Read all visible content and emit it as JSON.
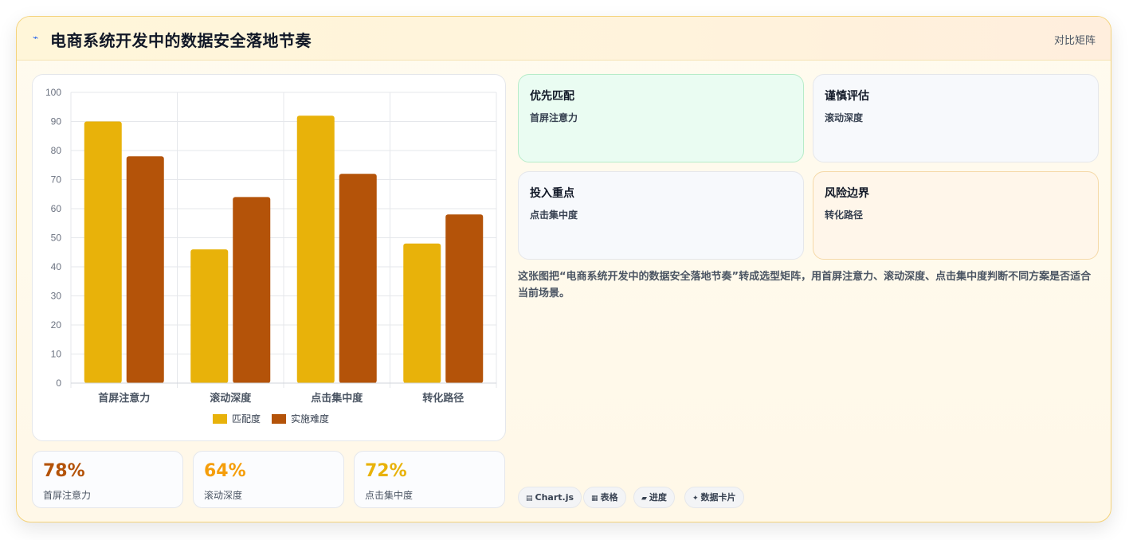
{
  "header": {
    "title": "电商系统开发中的数据安全落地节奏",
    "right_label": "对比矩阵"
  },
  "colors": {
    "series1": "#e8b20a",
    "series2": "#b45309",
    "grid": "#e5e7eb",
    "axis_text": "#6b7280"
  },
  "chart_data": {
    "type": "bar",
    "categories": [
      "首屏注意力",
      "滚动深度",
      "点击集中度",
      "转化路径"
    ],
    "series": [
      {
        "name": "匹配度",
        "values": [
          90,
          46,
          92,
          48
        ]
      },
      {
        "name": "实施难度",
        "values": [
          78,
          64,
          72,
          58
        ]
      }
    ],
    "ylim": [
      0,
      100
    ],
    "yticks": [
      0,
      10,
      20,
      30,
      40,
      50,
      60,
      70,
      80,
      90,
      100
    ],
    "legend": "bottom",
    "grid": true
  },
  "stats": [
    {
      "value": "78%",
      "label": "首屏注意力",
      "color": "#b45309"
    },
    {
      "value": "64%",
      "label": "滚动深度",
      "color": "#f59e0b"
    },
    {
      "value": "72%",
      "label": "点击集中度",
      "color": "#e8b20a"
    }
  ],
  "quadrants": [
    {
      "title": "优先匹配",
      "sub": "首屏注意力"
    },
    {
      "title": "谨慎评估",
      "sub": "滚动深度"
    },
    {
      "title": "投入重点",
      "sub": "点击集中度"
    },
    {
      "title": "风险边界",
      "sub": "转化路径"
    }
  ],
  "description": "这张图把“电商系统开发中的数据安全落地节奏”转成选型矩阵，用首屏注意力、滚动深度、点击集中度判断不同方案是否适合当前场景。",
  "tags": [
    {
      "icon": "bar-chart-icon",
      "glyph": "▤",
      "label": "Chart.js"
    },
    {
      "icon": "table-icon",
      "glyph": "▦",
      "label": "表格"
    },
    {
      "icon": "progress-icon",
      "glyph": "▰",
      "label": "进度"
    },
    {
      "icon": "sparkle-icon",
      "glyph": "✦",
      "label": "数据卡片"
    }
  ]
}
